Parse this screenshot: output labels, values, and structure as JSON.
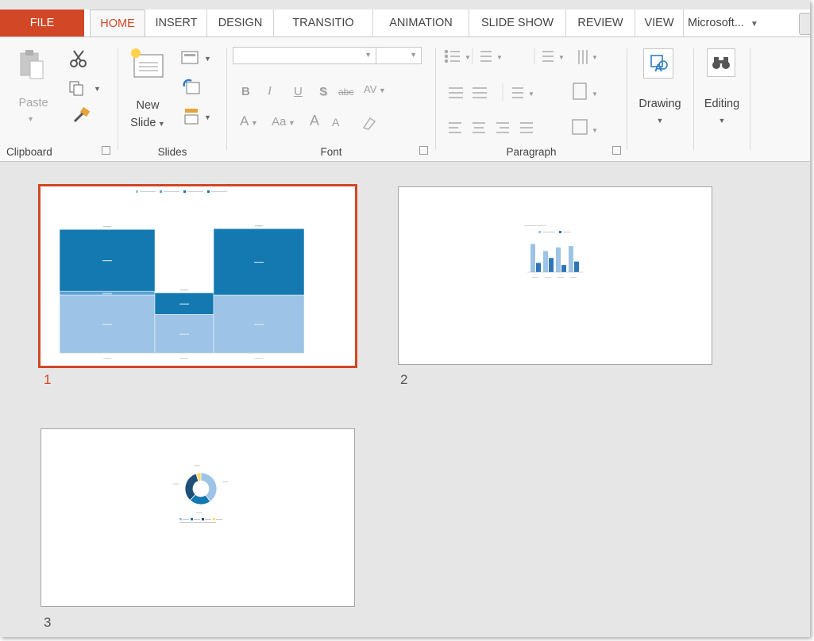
{
  "tabs": {
    "file": "FILE",
    "home": "HOME",
    "insert": "INSERT",
    "design": "DESIGN",
    "transitions": "TRANSITIO",
    "animations": "ANIMATION",
    "slideshow": "SLIDE SHOW",
    "review": "REVIEW",
    "view": "VIEW",
    "account": "Microsoft..."
  },
  "ribbon": {
    "clipboard": {
      "paste_label": "Paste",
      "group_label": "Clipboard"
    },
    "slides": {
      "new_slide_line1": "New",
      "new_slide_line2": "Slide",
      "group_label": "Slides"
    },
    "font": {
      "group_label": "Font",
      "bold": "B",
      "italic": "I",
      "underline": "U",
      "shadow": "S",
      "strike": "abc",
      "spacing": "AV",
      "color": "A",
      "case": "Aa",
      "grow": "A",
      "shrink": "A"
    },
    "paragraph": {
      "group_label": "Paragraph"
    },
    "drawing": {
      "label": "Drawing"
    },
    "editing": {
      "label": "Editing"
    }
  },
  "slides": [
    {
      "number": "1",
      "selected": true
    },
    {
      "number": "2",
      "selected": false
    },
    {
      "number": "3",
      "selected": false
    }
  ],
  "colors": {
    "accent": "#d24726",
    "dark_blue": "#1479b0",
    "light_blue": "#9dc3e6",
    "navy": "#1e4e79",
    "yellow": "#ffd966"
  },
  "chart_data": [
    {
      "type": "bar",
      "stacked": true,
      "slide": 1,
      "categories": [
        "",
        "",
        ""
      ],
      "series": [
        {
          "values": [
            75,
            50,
            75
          ]
        },
        {
          "values": [
            5,
            0,
            0
          ]
        },
        {
          "values": [
            80,
            28,
            86
          ]
        }
      ],
      "ylim": [
        0,
        190
      ],
      "legend": "top"
    },
    {
      "type": "bar",
      "slide": 2,
      "categories": [
        "",
        "",
        "",
        ""
      ],
      "series": [
        {
          "values": [
            40,
            30,
            35,
            37
          ]
        },
        {
          "values": [
            13,
            20,
            10,
            15
          ]
        }
      ],
      "ylim": [
        0,
        45
      ],
      "legend": "top"
    },
    {
      "type": "pie",
      "donut": true,
      "slide": 3,
      "values": [
        40,
        22,
        33,
        5
      ],
      "colors": [
        "#9dc3e6",
        "#1479b0",
        "#1e4e79",
        "#ffd966"
      ],
      "legend": "bottom"
    }
  ],
  "icons": {
    "paste": "paste-icon",
    "cut": "scissors-icon",
    "copy": "copy-icon",
    "format_painter": "brush-icon",
    "new_slide": "new-slide-icon",
    "layout": "layout-icon",
    "reset": "reset-icon",
    "section": "section-icon",
    "drawing": "shapes-icon",
    "editing": "binoculars-icon"
  }
}
